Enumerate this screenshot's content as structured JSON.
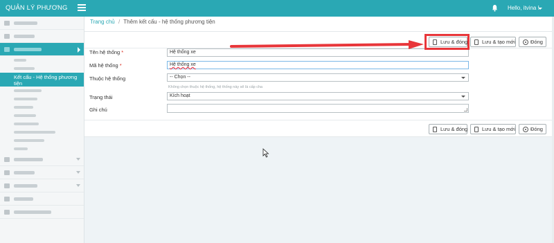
{
  "header": {
    "brand": "QUẢN LÝ PHƯƠNG TIỆN",
    "user_greeting": "Hello, itvina !"
  },
  "sidebar": {
    "current_item": [
      "Kết cấu - Hệ thống phương",
      "tiện"
    ]
  },
  "breadcrumb": {
    "home": "Trang chủ",
    "separator": "/",
    "current": "Thêm kết cấu - hệ thống phương tiện"
  },
  "toolbar": {
    "save_close": "Lưu & đóng",
    "save_new": "Lưu & tạo mới",
    "close": "Đóng"
  },
  "form": {
    "system_name": {
      "label": "Tên hệ thống",
      "required": "*",
      "value": "Hệ thống xe"
    },
    "system_code": {
      "label": "Mã hệ thống",
      "required": "*",
      "value": "Hệ thống xe"
    },
    "parent_system": {
      "label": "Thuộc hệ thống",
      "value": "-- Chọn --",
      "hint": "Không chọn thuộc hệ thống, hệ thống này sẽ là cấp cha"
    },
    "status": {
      "label": "Trạng thái",
      "value": "Kích hoạt"
    },
    "note": {
      "label": "Ghi chú",
      "value": ""
    }
  },
  "colors": {
    "accent": "#2aa8b4",
    "highlight": "#e8363a",
    "required": "#d9281c"
  }
}
